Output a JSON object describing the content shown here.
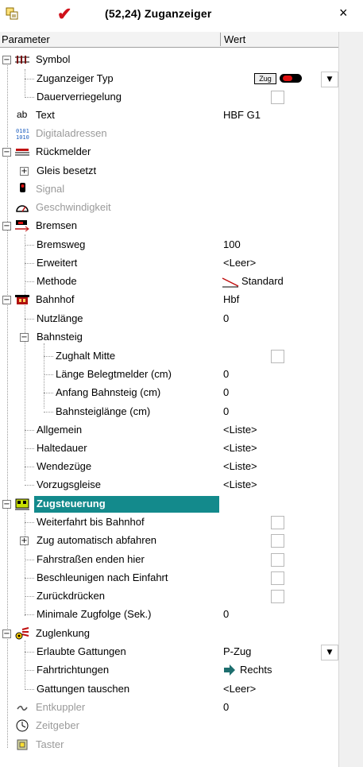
{
  "window": {
    "title": "(52,24)  Zuganzeiger",
    "close": "×"
  },
  "header": {
    "param": "Parameter",
    "wert": "Wert"
  },
  "rows": {
    "symbol": {
      "label": "Symbol"
    },
    "zuganzeiger_typ": {
      "label": "Zuganzeiger Typ",
      "badge": "Zug"
    },
    "dauerverriegelung": {
      "label": "Dauerverriegelung",
      "checked": false
    },
    "text": {
      "icon": "ab",
      "label": "Text",
      "value": "HBF G1"
    },
    "digitaladressen": {
      "label": "Digitaladressen"
    },
    "rueckmelder": {
      "label": "Rückmelder"
    },
    "gleis_besetzt": {
      "label": "Gleis besetzt"
    },
    "signal": {
      "label": "Signal"
    },
    "geschwindigkeit": {
      "label": "Geschwindigkeit"
    },
    "bremsen": {
      "label": "Bremsen"
    },
    "bremsweg": {
      "label": "Bremsweg",
      "value": "100"
    },
    "erweitert": {
      "label": "Erweitert",
      "value": "<Leer>"
    },
    "methode": {
      "label": "Methode",
      "value": "Standard"
    },
    "bahnhof": {
      "label": "Bahnhof",
      "value": "Hbf"
    },
    "nutzlaenge": {
      "label": "Nutzlänge",
      "value": "0"
    },
    "bahnsteig": {
      "label": "Bahnsteig"
    },
    "zughalt_mitte": {
      "label": "Zughalt Mitte",
      "checked": false
    },
    "laenge_belegtmelder": {
      "label": "Länge Belegtmelder (cm)",
      "value": "0"
    },
    "anfang_bahnsteig": {
      "label": "Anfang Bahnsteig (cm)",
      "value": "0"
    },
    "bahnsteiglaenge": {
      "label": "Bahnsteiglänge (cm)",
      "value": "0"
    },
    "allgemein": {
      "label": "Allgemein",
      "value": "<Liste>"
    },
    "haltedauer": {
      "label": "Haltedauer",
      "value": "<Liste>"
    },
    "wendezuege": {
      "label": "Wendezüge",
      "value": "<Liste>"
    },
    "vorzugsgleise": {
      "label": "Vorzugsgleise",
      "value": "<Liste>"
    },
    "zugsteuerung": {
      "label": "Zugsteuerung"
    },
    "weiterfahrt": {
      "label": "Weiterfahrt bis Bahnhof",
      "checked": false
    },
    "zug_auto_abfahren": {
      "label": "Zug automatisch abfahren",
      "checked": false
    },
    "fahrstrassen_enden": {
      "label": "Fahrstraßen enden hier",
      "checked": false
    },
    "beschleunigen": {
      "label": "Beschleunigen nach Einfahrt",
      "checked": false
    },
    "zurueckdruecken": {
      "label": "Zurückdrücken",
      "checked": false
    },
    "min_zugfolge": {
      "label": "Minimale Zugfolge (Sek.)",
      "value": "0"
    },
    "zuglenkung": {
      "label": "Zuglenkung"
    },
    "erlaubte_gattungen": {
      "label": "Erlaubte Gattungen",
      "value": "P-Zug"
    },
    "fahrtrichtungen": {
      "label": "Fahrtrichtungen",
      "value": "Rechts"
    },
    "gattungen_tauschen": {
      "label": "Gattungen tauschen",
      "value": "<Leer>"
    },
    "entkuppler": {
      "label": "Entkuppler",
      "value": "0"
    },
    "zeitgeber": {
      "label": "Zeitgeber"
    },
    "taster": {
      "label": "Taster"
    }
  },
  "colors": {
    "selection": "#138a8c",
    "check": "#d0101a",
    "disabled": "#9a9a9a"
  },
  "icons": [
    "properties-icon",
    "checkmark-icon",
    "close-icon",
    "rail-symbol-icon",
    "text-ab-icon",
    "digital-address-icon",
    "feedback-sensor-icon",
    "signal-icon",
    "speedometer-icon",
    "brake-icon",
    "station-icon",
    "train-control-icon",
    "route-icon",
    "uncoupler-icon",
    "clock-icon",
    "button-icon",
    "arrow-right-icon",
    "chevron-down-icon"
  ]
}
